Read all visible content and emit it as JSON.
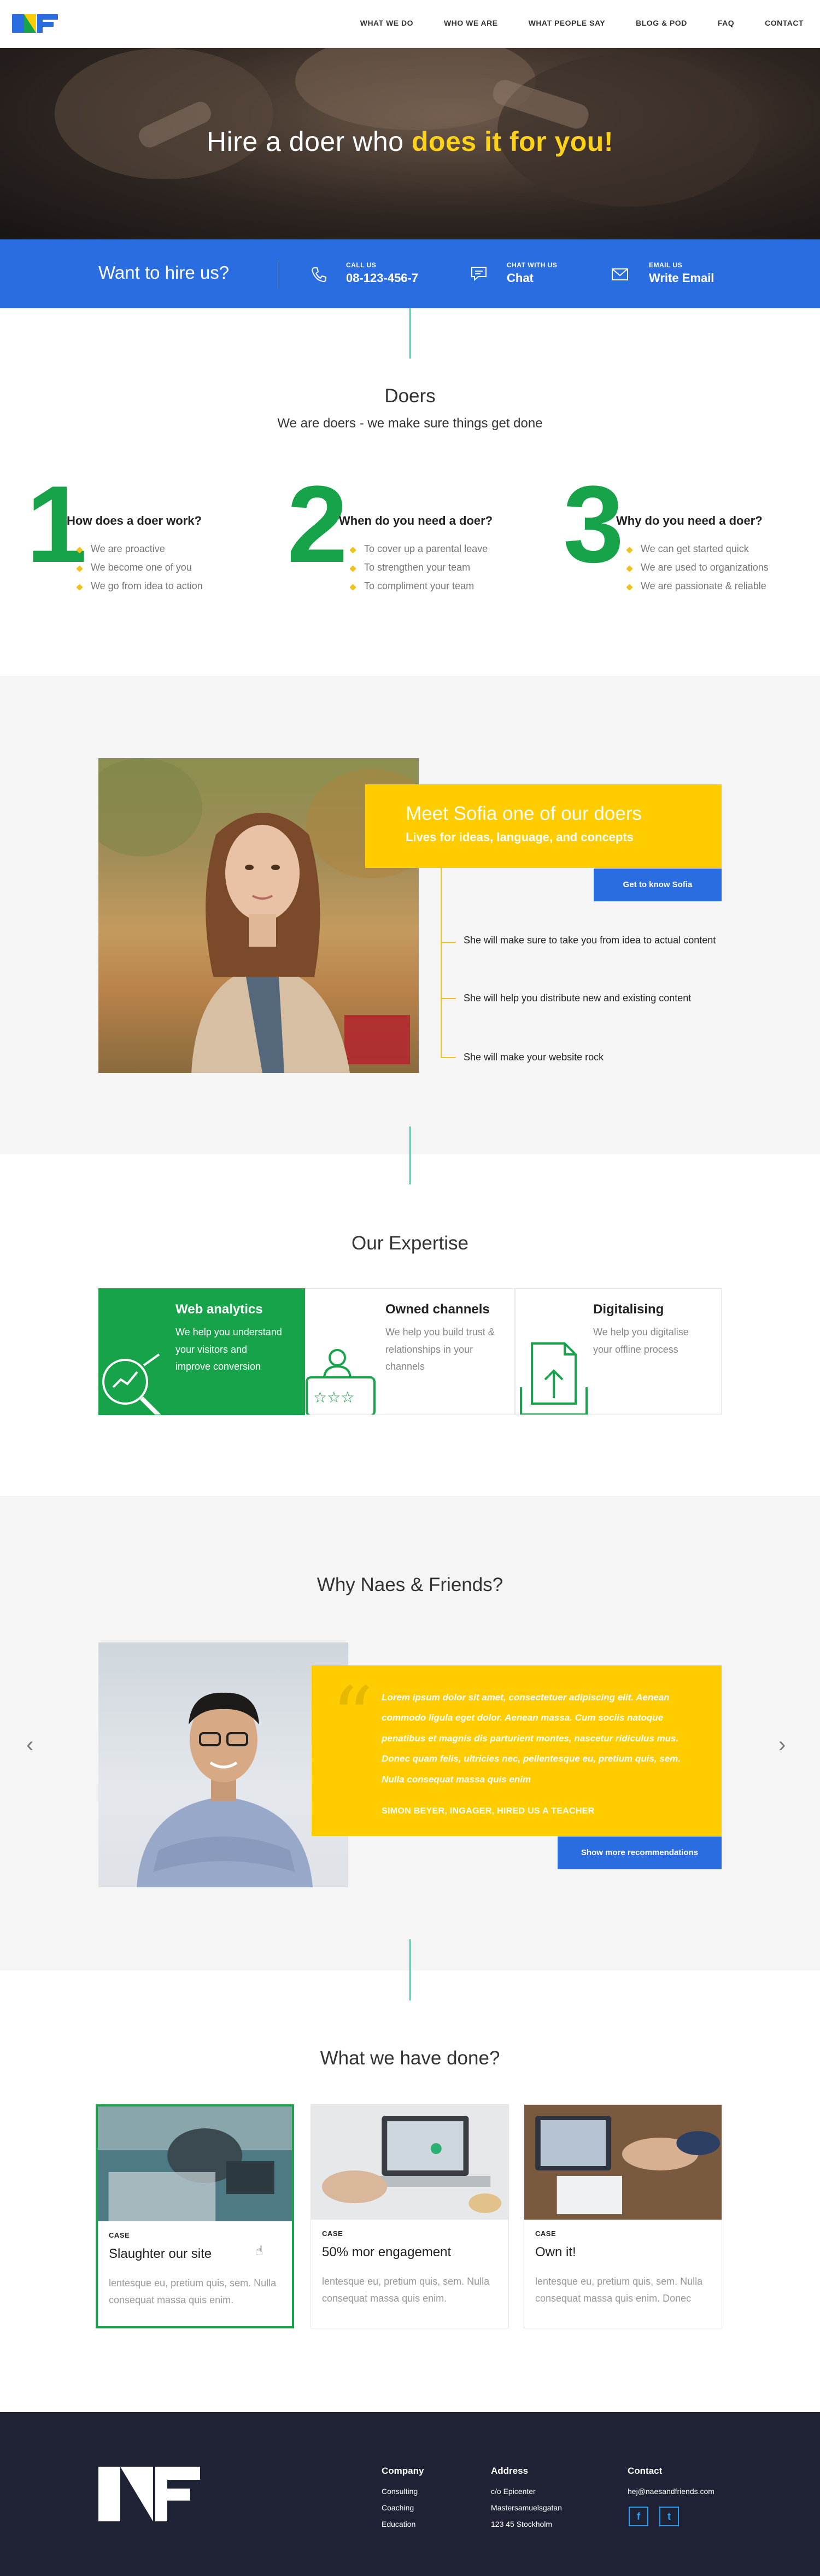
{
  "header": {
    "nav": [
      "WHAT WE DO",
      "WHO WE ARE",
      "WHAT PEOPLE SAY",
      "BLOG & POD",
      "FAQ",
      "CONTACT"
    ]
  },
  "hero": {
    "title_plain": "Hire a doer who ",
    "title_highlight": "does it for you!"
  },
  "hire_bar": {
    "lead": "Want to hire us?",
    "items": [
      {
        "label": "CALL US",
        "value": "08-123-456-7",
        "icon": "phone-icon"
      },
      {
        "label": "CHAT WITH US",
        "value": "Chat",
        "icon": "chat-icon"
      },
      {
        "label": "EMAIL US",
        "value": "Write Email",
        "icon": "mail-icon"
      }
    ]
  },
  "doers": {
    "title": "Doers",
    "subtitle": "We are doers - we make sure things get done",
    "columns": [
      {
        "number": "1",
        "title": "How does a doer work?",
        "items": [
          "We are proactive",
          "We become one of you",
          "We go from idea to action"
        ]
      },
      {
        "number": "2",
        "title": "When do you need a doer?",
        "items": [
          "To cover up a parental leave",
          "To strengthen your team",
          "To compliment your team"
        ]
      },
      {
        "number": "3",
        "title": "Why do you need a doer?",
        "items": [
          "We can get started quick",
          "We are used to organizations",
          "We are passionate & reliable"
        ]
      }
    ]
  },
  "sofia": {
    "title": "Meet Sofia one of our doers",
    "subtitle": "Lives for ideas, language, and concepts",
    "button": "Get to know Sofia",
    "timeline": [
      "She will make sure to take you from idea to actual content",
      "She will help you distribute new and existing content",
      "She will make your website rock"
    ]
  },
  "expertise": {
    "title": "Our Expertise",
    "cards": [
      {
        "title": "Web analytics",
        "desc": "We help you understand your visitors and improve conversion",
        "icon": "analytics-magnifier-icon"
      },
      {
        "title": "Owned channels",
        "desc": "We help you build trust & relationships in your channels",
        "icon": "rating-user-icon"
      },
      {
        "title": "Digitalising",
        "desc": "We help you digitalise your offline process",
        "icon": "document-upload-icon"
      }
    ]
  },
  "why": {
    "title": "Why Naes & Friends?",
    "quote": "Lorem ipsum dolor sit amet, consectetuer adipiscing elit. Aenean commodo ligula eget dolor. Aenean massa. Cum sociis natoque penatibus et magnis dis parturient montes, nascetur ridiculus mus. Donec quam felis, ultricies nec, pellentesque eu, pretium quis, sem. Nulla consequat massa quis enim",
    "author": "SIMON BEYER, INGAGER, HIRED US A TEACHER",
    "button": "Show more recommendations"
  },
  "done": {
    "title": "What we have done?",
    "cases": [
      {
        "label": "CASE",
        "title": "Slaughter our site",
        "desc": "lentesque eu, pretium quis, sem. Nulla consequat massa quis enim."
      },
      {
        "label": "CASE",
        "title": "50% mor engagement",
        "desc": "lentesque eu, pretium quis, sem. Nulla consequat massa quis enim."
      },
      {
        "label": "CASE",
        "title": "Own it!",
        "desc": "lentesque eu, pretium quis, sem. Nulla consequat massa quis enim. Donec"
      }
    ]
  },
  "footer": {
    "company": {
      "head": "Company",
      "items": [
        "Consulting",
        "Coaching",
        "Education"
      ]
    },
    "address": {
      "head": "Address",
      "items": [
        "c/o Epicenter",
        "Mastersamuelsgatan",
        "123 45 Stockholm"
      ]
    },
    "contact": {
      "head": "Contact",
      "email": "hej@naesandfriends.com"
    },
    "social": [
      "f",
      "t"
    ]
  },
  "colors": {
    "brand_blue": "#2a6de0",
    "brand_green": "#17a34a",
    "brand_yellow": "#ffcc00",
    "footer_bg": "#1f2235"
  }
}
